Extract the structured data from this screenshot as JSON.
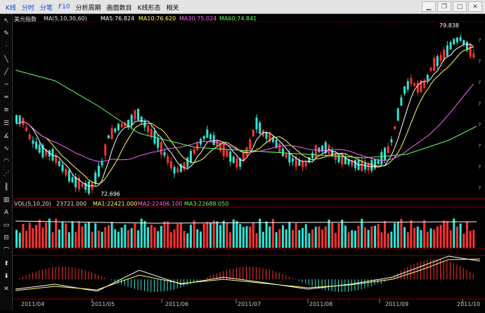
{
  "header": {
    "tabs": [
      {
        "label": "K线",
        "style": "active"
      },
      {
        "label": "分时",
        "style": "blue"
      },
      {
        "label": "分笔",
        "style": "blue"
      },
      {
        "label": "F10",
        "style": "blue"
      },
      {
        "label": "分析周期",
        "style": "normal"
      },
      {
        "label": "画面数目",
        "style": "normal"
      },
      {
        "label": "K线形态",
        "style": "normal"
      },
      {
        "label": "相关",
        "style": "normal"
      }
    ]
  },
  "window_controls": [
    "minimize-icon",
    "restore-icon",
    "maximize-icon",
    "close-icon"
  ],
  "toolbar_icons": [
    "cursor-icon",
    "pen-icon",
    "dot-icon",
    "line-icon",
    "ray-icon",
    "segment-icon",
    "parallel-icon",
    "channel-icon",
    "fib-icon",
    "gann-icon",
    "wave-icon",
    "cycle-icon",
    "fan-icon",
    "period-icon",
    "bars-icon",
    "text-icon",
    "rect-icon",
    "measure-icon",
    "arc-icon",
    "up-arrow-icon",
    "down-arrow-icon",
    "erase-icon"
  ],
  "main_panel": {
    "instrument": "美元指数",
    "ma_label": "MA(5,10,30,60)",
    "ma5": "MA5:76.824",
    "ma10": "MA10:76.620",
    "ma30": "MA30:75.024",
    "ma60": "MA60:74.841",
    "high_label": "79.838",
    "low_label": "72.696"
  },
  "volume_panel": {
    "label": "VOL(5,10,20)",
    "value": "23721.000",
    "ma1": "MA1:22421.000",
    "ma2": "MA2:22406.100",
    "ma3": "MA3:22688.050"
  },
  "x_labels": [
    "2011/04",
    "2011/05",
    "2011/06",
    "2011/07",
    "2011/08",
    "2011/09",
    "2011/10"
  ],
  "colors": {
    "up": "#ff3232",
    "down": "#2ee6d6",
    "ma5": "#ffffff",
    "ma10": "#ffff66",
    "ma30": "#ff66ff",
    "ma60": "#66ff66",
    "grid": "#8b0000"
  }
}
